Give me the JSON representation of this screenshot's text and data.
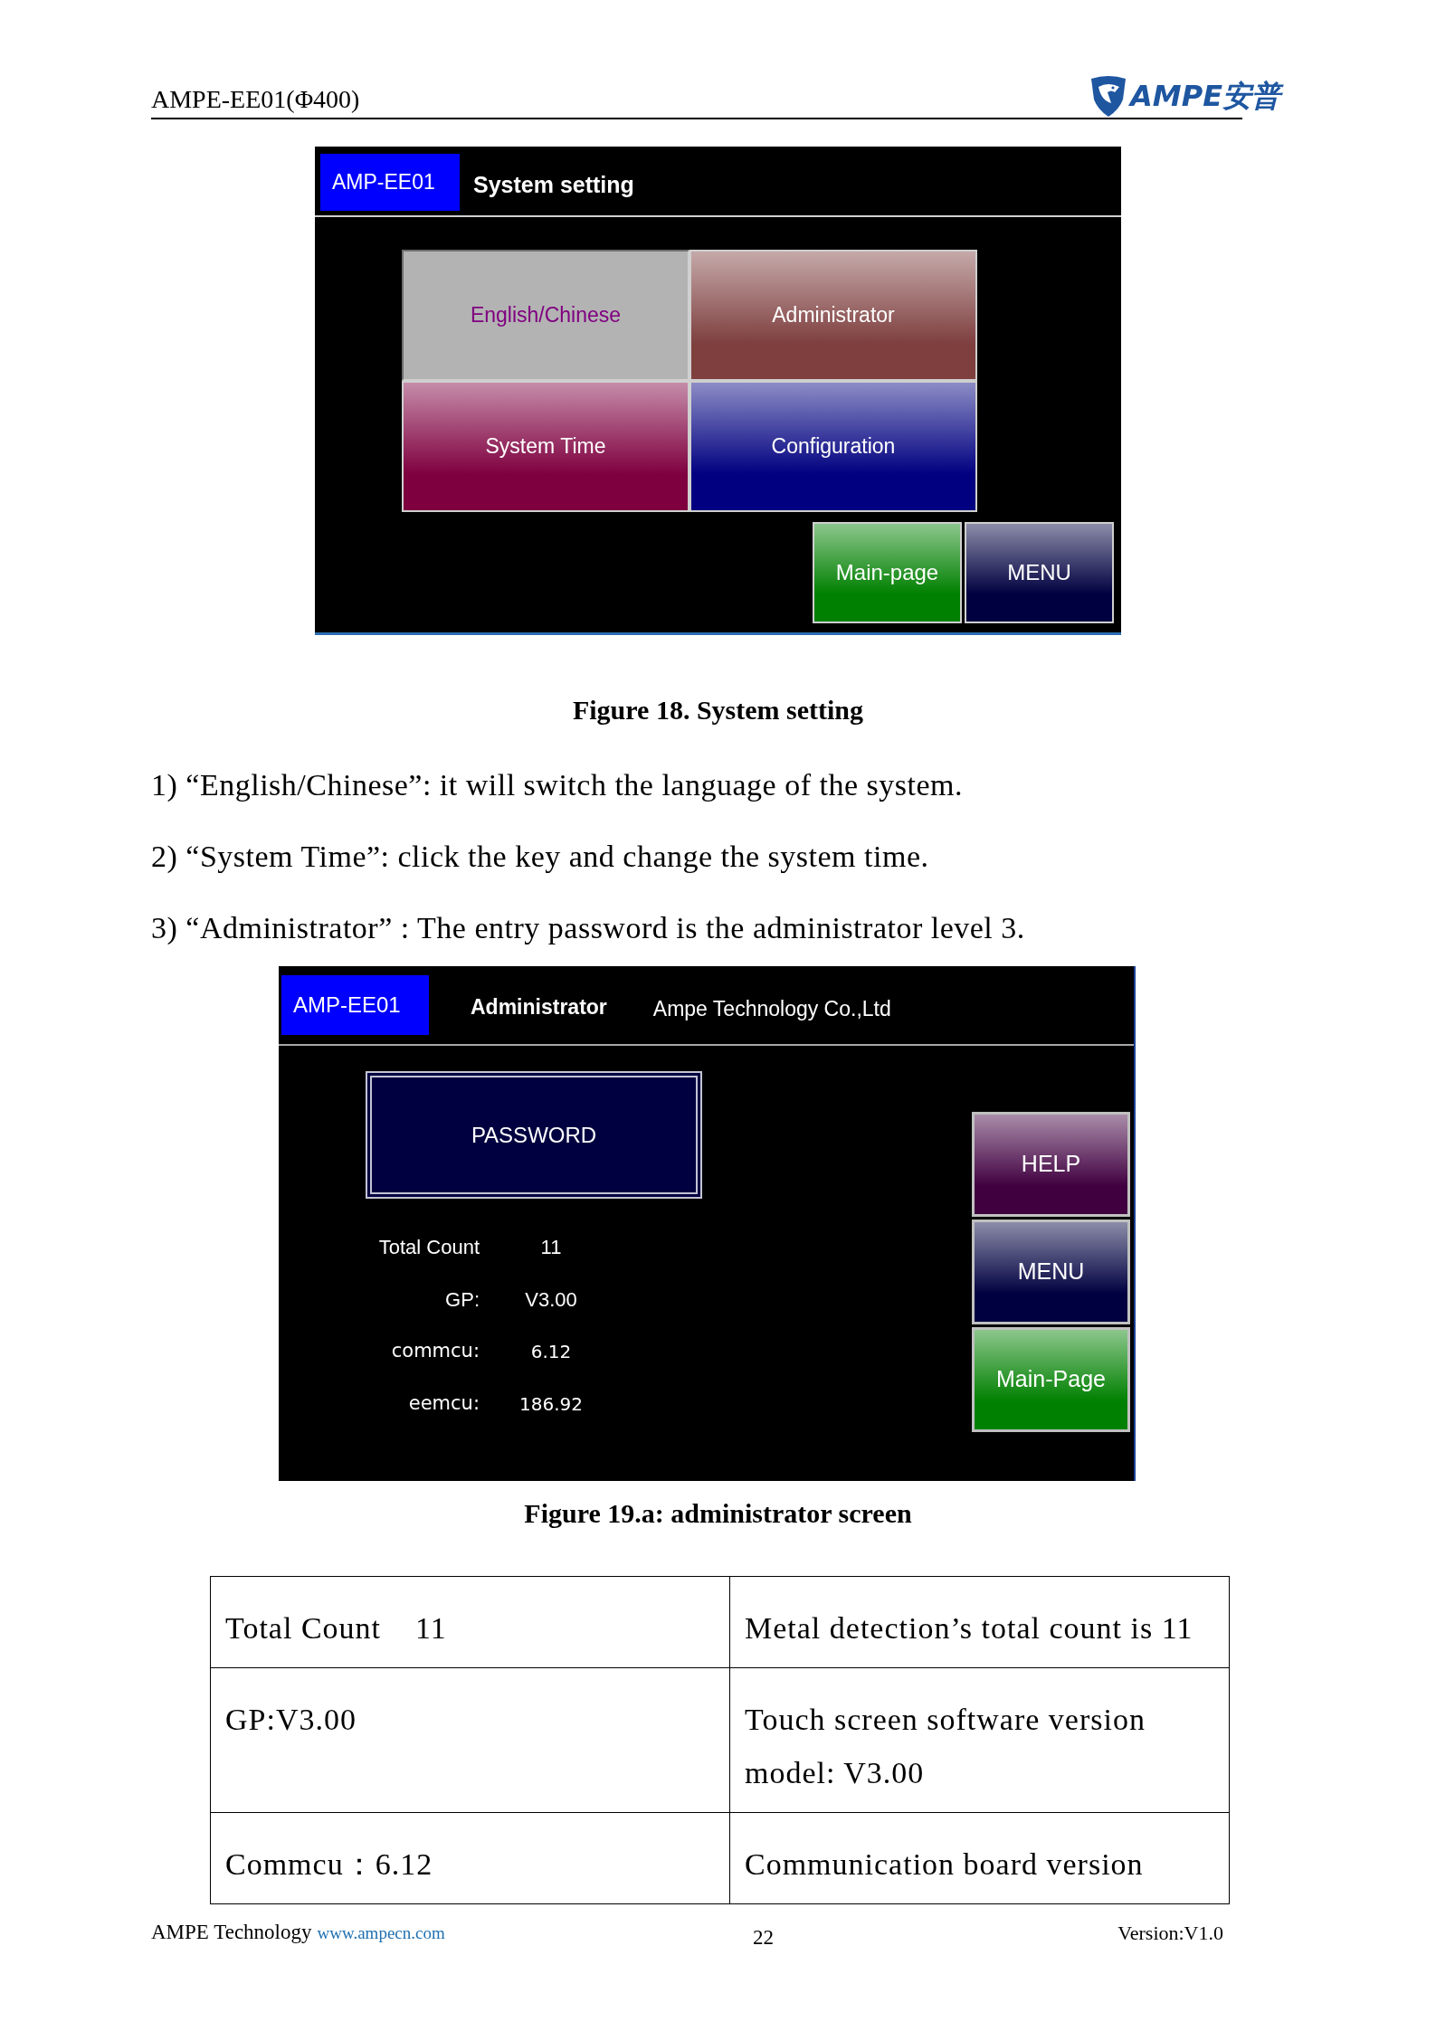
{
  "header": {
    "title": "AMPE-EE01(Φ400)",
    "logo_text": "AMPE安普"
  },
  "system_setting_screen": {
    "badge": "AMP-EE01",
    "title": "System setting",
    "tiles": [
      {
        "label": "English/Chinese",
        "color": "#800080",
        "selected": true
      },
      {
        "label": "Administrator",
        "color": "#7f3f3f",
        "selected": false
      },
      {
        "label": "System Time",
        "color": "#7f003f",
        "selected": false
      },
      {
        "label": "Configuration",
        "color": "#000080",
        "selected": false
      }
    ],
    "buttons": [
      {
        "label": "Main-page",
        "color": "#008000"
      },
      {
        "label": "MENU",
        "color": "#000040"
      }
    ]
  },
  "figure_18_caption": "Figure 18. System setting",
  "steps": [
    "1) “English/Chinese”: it will switch the language of the system.",
    "2) “System Time”: click the key and change the system time.",
    "3) “Administrator” : The entry password is the administrator level 3."
  ],
  "administrator_screen": {
    "badge": "AMP-EE01",
    "title": "Administrator",
    "company": "Ampe Technology Co.,Ltd",
    "password_button": "PASSWORD",
    "info": [
      {
        "label": "Total Count",
        "value": "11"
      },
      {
        "label": "GP:",
        "value": "V3.00"
      },
      {
        "label": "commcu:",
        "value": "6.12"
      },
      {
        "label": "eemcu:",
        "value": "186.92"
      }
    ],
    "buttons": [
      {
        "label": "HELP",
        "color": "#400040"
      },
      {
        "label": "MENU",
        "color": "#000040"
      },
      {
        "label": "Main-Page",
        "color": "#008000"
      }
    ]
  },
  "figure_19a_caption": "Figure 19.a: administrator screen",
  "table": {
    "rows": [
      [
        "Total Count    11",
        "Metal detection’s total count is 11"
      ],
      [
        "GP:V3.00",
        "Touch screen software version model: V3.00"
      ],
      [
        "Commcu：6.12",
        "Communication board version"
      ]
    ]
  },
  "footer": {
    "company": "AMPE Technology",
    "link": "www.ampecn.com",
    "page": "22",
    "version": "Version:V1.0"
  }
}
